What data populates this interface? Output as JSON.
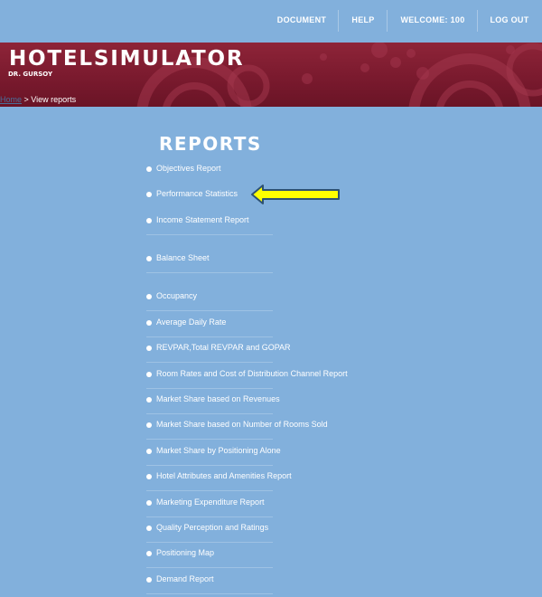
{
  "nav": {
    "document": "DOCUMENT",
    "help": "HELP",
    "welcome": "WELCOME: 100",
    "logout": "LOG OUT"
  },
  "banner": {
    "title": "HOTELSIMULATOR",
    "subtitle": "DR. GURSOY"
  },
  "breadcrumb": {
    "home": "Home",
    "separator": " > ",
    "current": "View reports"
  },
  "reports": {
    "heading": "REPORTS",
    "items": [
      {
        "label": "Objectives Report"
      },
      {
        "label": "Performance Statistics"
      },
      {
        "label": "Income Statement Report"
      },
      {
        "label": "Balance Sheet"
      },
      {
        "label": "Occupancy"
      },
      {
        "label": "Average Daily Rate"
      },
      {
        "label": "REVPAR,Total REVPAR and GOPAR"
      },
      {
        "label": "Room Rates and Cost of Distribution Channel Report"
      },
      {
        "label": "Market Share based on Revenues"
      },
      {
        "label": "Market Share based on Number of Rooms Sold"
      },
      {
        "label": "Market Share by Positioning Alone"
      },
      {
        "label": "Hotel Attributes and Amenities Report"
      },
      {
        "label": "Marketing Expenditure Report"
      },
      {
        "label": "Quality Perception and Ratings"
      },
      {
        "label": "Positioning Map"
      },
      {
        "label": "Demand Report"
      }
    ]
  },
  "colors": {
    "background": "#82b0dc",
    "banner": "#7a1a2e",
    "arrow_fill": "#ffff00",
    "arrow_outline": "#2e5272"
  },
  "annotation": {
    "icon": "arrow-left-icon",
    "points_to": "Performance Statistics"
  }
}
